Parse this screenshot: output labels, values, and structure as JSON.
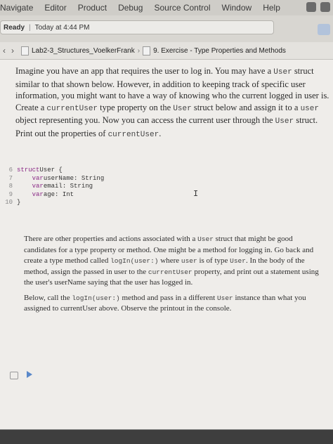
{
  "menu": {
    "items": [
      "Navigate",
      "Editor",
      "Product",
      "Debug",
      "Source Control",
      "Window",
      "Help"
    ]
  },
  "status": {
    "state": "Ready",
    "time": "Today at 4:44 PM"
  },
  "jump_bar": {
    "project": "Lab2-3_Structures_VoelkerFrank",
    "page": "9. Exercise - Type Properties and Methods"
  },
  "prose1": {
    "t1": "Imagine you have an app that requires the user to log in. You may have a ",
    "c1": "User",
    "t2": " struct similar to that shown below. However, in addition to keeping track of specific user information, you might want to have a way of knowing who the current logged in user is. Create a ",
    "c2": "currentUser",
    "t3": " type property on the ",
    "c3": "User",
    "t4": " struct below and assign it to a ",
    "c4": "user",
    "t5": " object representing you. Now you can access the current user through the ",
    "c5": "User",
    "t6": " struct. Print out the properties of ",
    "c6": "currentUser",
    "t7": "."
  },
  "code": [
    {
      "num": "6",
      "kw": "struct",
      "rest": " User {"
    },
    {
      "num": "7",
      "kw": "    var",
      "rest": " userName: String"
    },
    {
      "num": "8",
      "kw": "    var",
      "rest": " email: String"
    },
    {
      "num": "9",
      "kw": "    var",
      "rest": " age: Int"
    },
    {
      "num": "10",
      "kw": "",
      "rest": "}"
    }
  ],
  "prose2": {
    "p1_t1": "There are other properties and actions associated with a ",
    "p1_c1": "User",
    "p1_t2": " struct that might be good candidates for a type property or method. One might be a method for logging in. Go back and create a type method called ",
    "p1_c2": "logIn(user:)",
    "p1_t3": " where ",
    "p1_c3": "user",
    "p1_t4": " is of type ",
    "p1_c4": "User",
    "p1_t5": ". In the body of the method, assign the passed in user to the ",
    "p1_c5": "currentUser",
    "p1_t6": " property, and print out a statement using the user's userName saying that the user has logged in.",
    "p2_t1": "Below, call the ",
    "p2_c1": "logIn(user:)",
    "p2_t2": " method and pass in a different ",
    "p2_c2": "User",
    "p2_t3": " instance than what you assigned to currentUser above. Observe the printout in the console."
  },
  "icons": {
    "back": "chevron-left-icon",
    "forward": "chevron-right-icon",
    "file": "file-icon",
    "run": "play-icon"
  },
  "colors": {
    "keyword": "#8a2a86",
    "run_arrow": "#5a88c9"
  }
}
